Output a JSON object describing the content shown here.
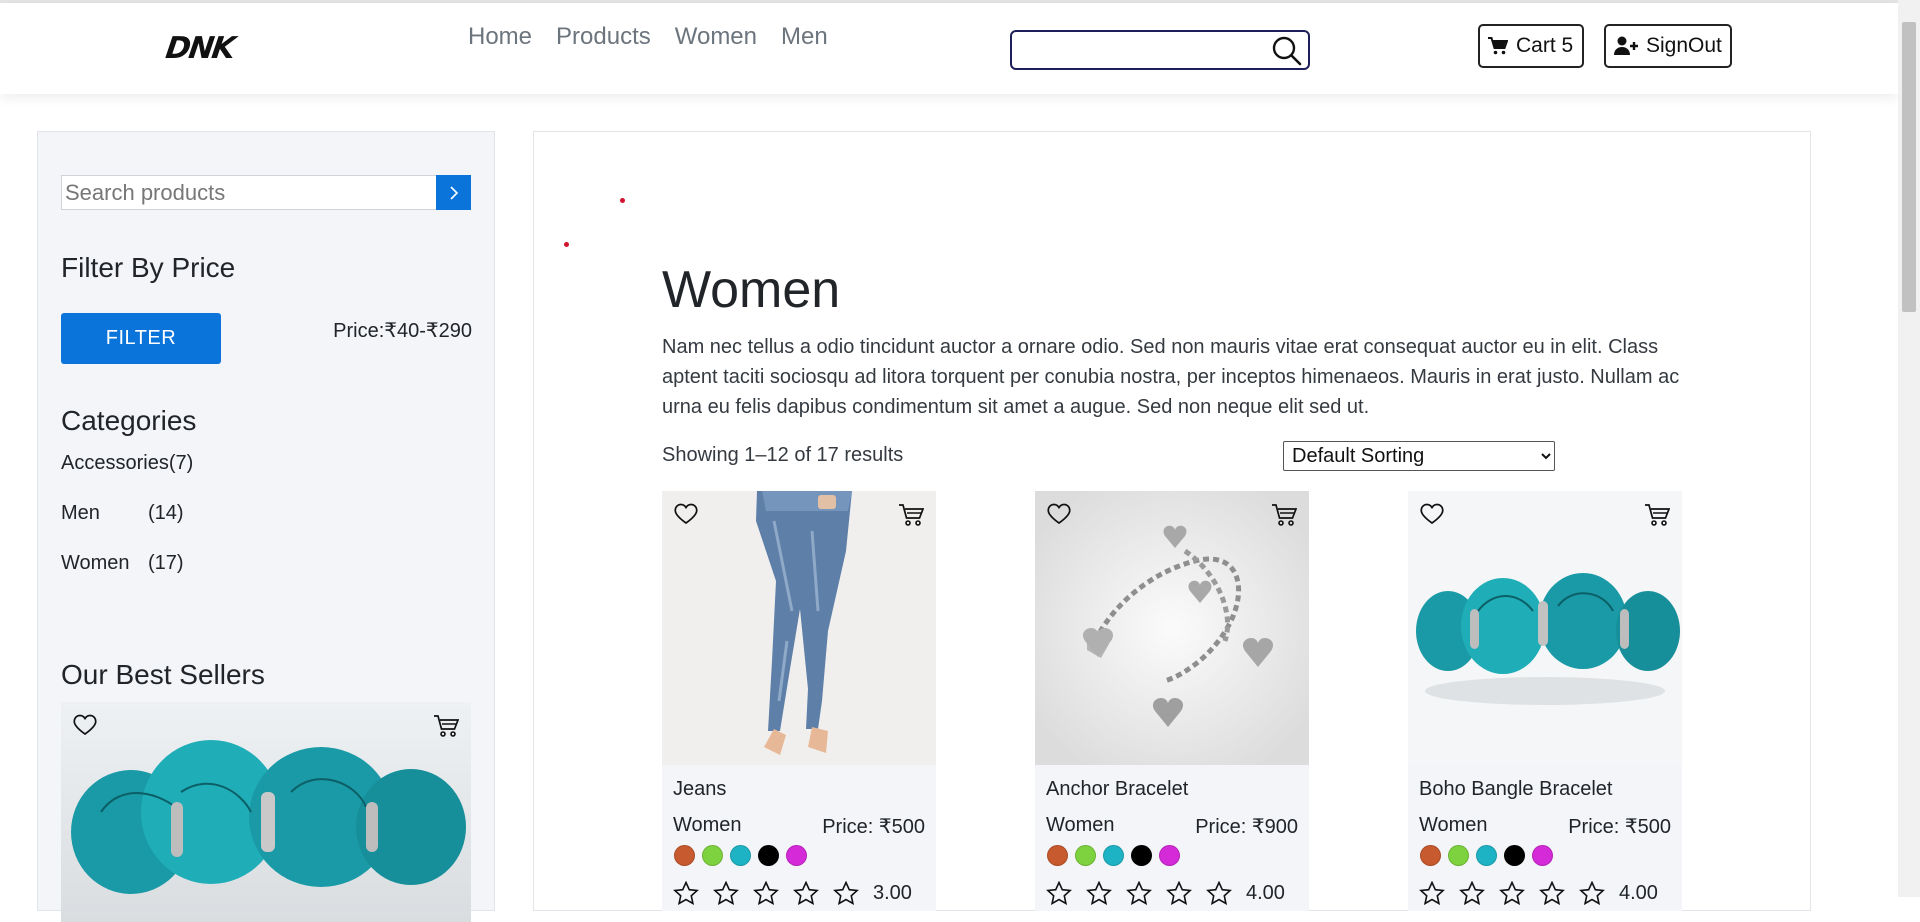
{
  "header": {
    "logo": "DNK",
    "nav": [
      "Home",
      "Products",
      "Women",
      "Men"
    ],
    "search_value": "",
    "cart_label": "Cart 5",
    "signout_label": "SignOut"
  },
  "sidebar": {
    "search_placeholder": "Search products",
    "filter_heading": "Filter By Price",
    "filter_button": "FILTER",
    "price_range": "Price:₹40-₹290",
    "categories_heading": "Categories",
    "categories": [
      {
        "name": "Accessories",
        "count": "(7)"
      },
      {
        "name": "Men",
        "count": "(14)"
      },
      {
        "name": "Women",
        "count": "(17)"
      }
    ],
    "bestsellers_heading": "Our Best Sellers"
  },
  "main": {
    "title": "Women",
    "description": "Nam nec tellus a odio tincidunt auctor a ornare odio. Sed non mauris vitae erat consequat auctor eu in elit. Class aptent taciti sociosqu ad litora torquent per conubia nostra, per inceptos himenaeos. Mauris in erat justo. Nullam ac urna eu felis dapibus condimentum sit amet a augue. Sed non neque elit sed ut.",
    "results_text": "Showing 1–12 of 17 results",
    "sort_selected": "Default Sorting",
    "products": [
      {
        "name": "Jeans",
        "category": "Women",
        "price": "Price: ₹500",
        "rating": "3.00"
      },
      {
        "name": "Anchor Bracelet",
        "category": "Women",
        "price": "Price: ₹900",
        "rating": "4.00"
      },
      {
        "name": "Boho Bangle Bracelet",
        "category": "Women",
        "price": "Price: ₹500",
        "rating": "4.00"
      }
    ]
  },
  "colors": {
    "accent": "#0a74da",
    "swatches": [
      "#c75a2e",
      "#7ed13f",
      "#1eb3c4",
      "#000000",
      "#d42ad8"
    ]
  }
}
